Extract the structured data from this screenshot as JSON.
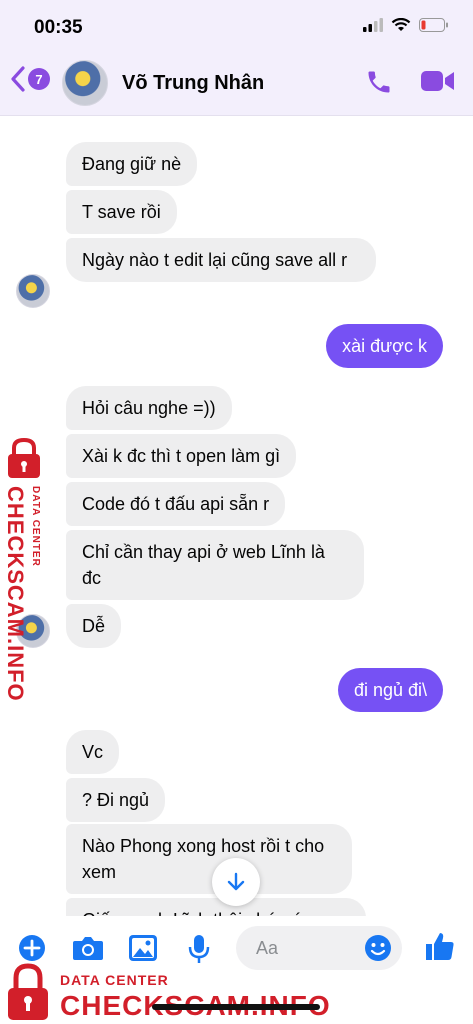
{
  "status": {
    "time": "00:35"
  },
  "header": {
    "back_count": "7",
    "contact_name": "Võ Trung Nhân"
  },
  "messages": [
    {
      "dir": "in",
      "text": "Đang giữ nè"
    },
    {
      "dir": "in",
      "text": "T save rồi"
    },
    {
      "dir": "in",
      "text": "Ngày nào t edit lại cũng save all r"
    },
    {
      "dir": "out",
      "text": "xài được k"
    },
    {
      "dir": "in",
      "text": "Hỏi câu nghe =))"
    },
    {
      "dir": "in",
      "text": "Xài k đc thì t open làm gì"
    },
    {
      "dir": "in",
      "text": "Code đó t đấu api sẵn r"
    },
    {
      "dir": "in",
      "text": "Chỉ cần thay api ở web Lĩnh là đc"
    },
    {
      "dir": "in",
      "text": "Dễ"
    },
    {
      "dir": "out",
      "text": "đi ngủ đi\\"
    },
    {
      "dir": "in",
      "text": "Vc"
    },
    {
      "dir": "in",
      "text": "? Đi ngủ"
    },
    {
      "dir": "in",
      "text": "Nào Phong xong host rồi t cho xem"
    },
    {
      "dir": "in",
      "text": "Giống web Lĩnh thôi chứ có"
    }
  ],
  "composer": {
    "placeholder": "Aa"
  },
  "watermark": {
    "small": "DATA CENTER",
    "big": "CHECKSCAM.INFO"
  },
  "colors": {
    "accent": "#8a4be0",
    "outgoing_bubble": "#7651f4",
    "incoming_bubble": "#eeeeef",
    "blue_icons": "#1877f2",
    "watermark": "#d21f2a"
  }
}
